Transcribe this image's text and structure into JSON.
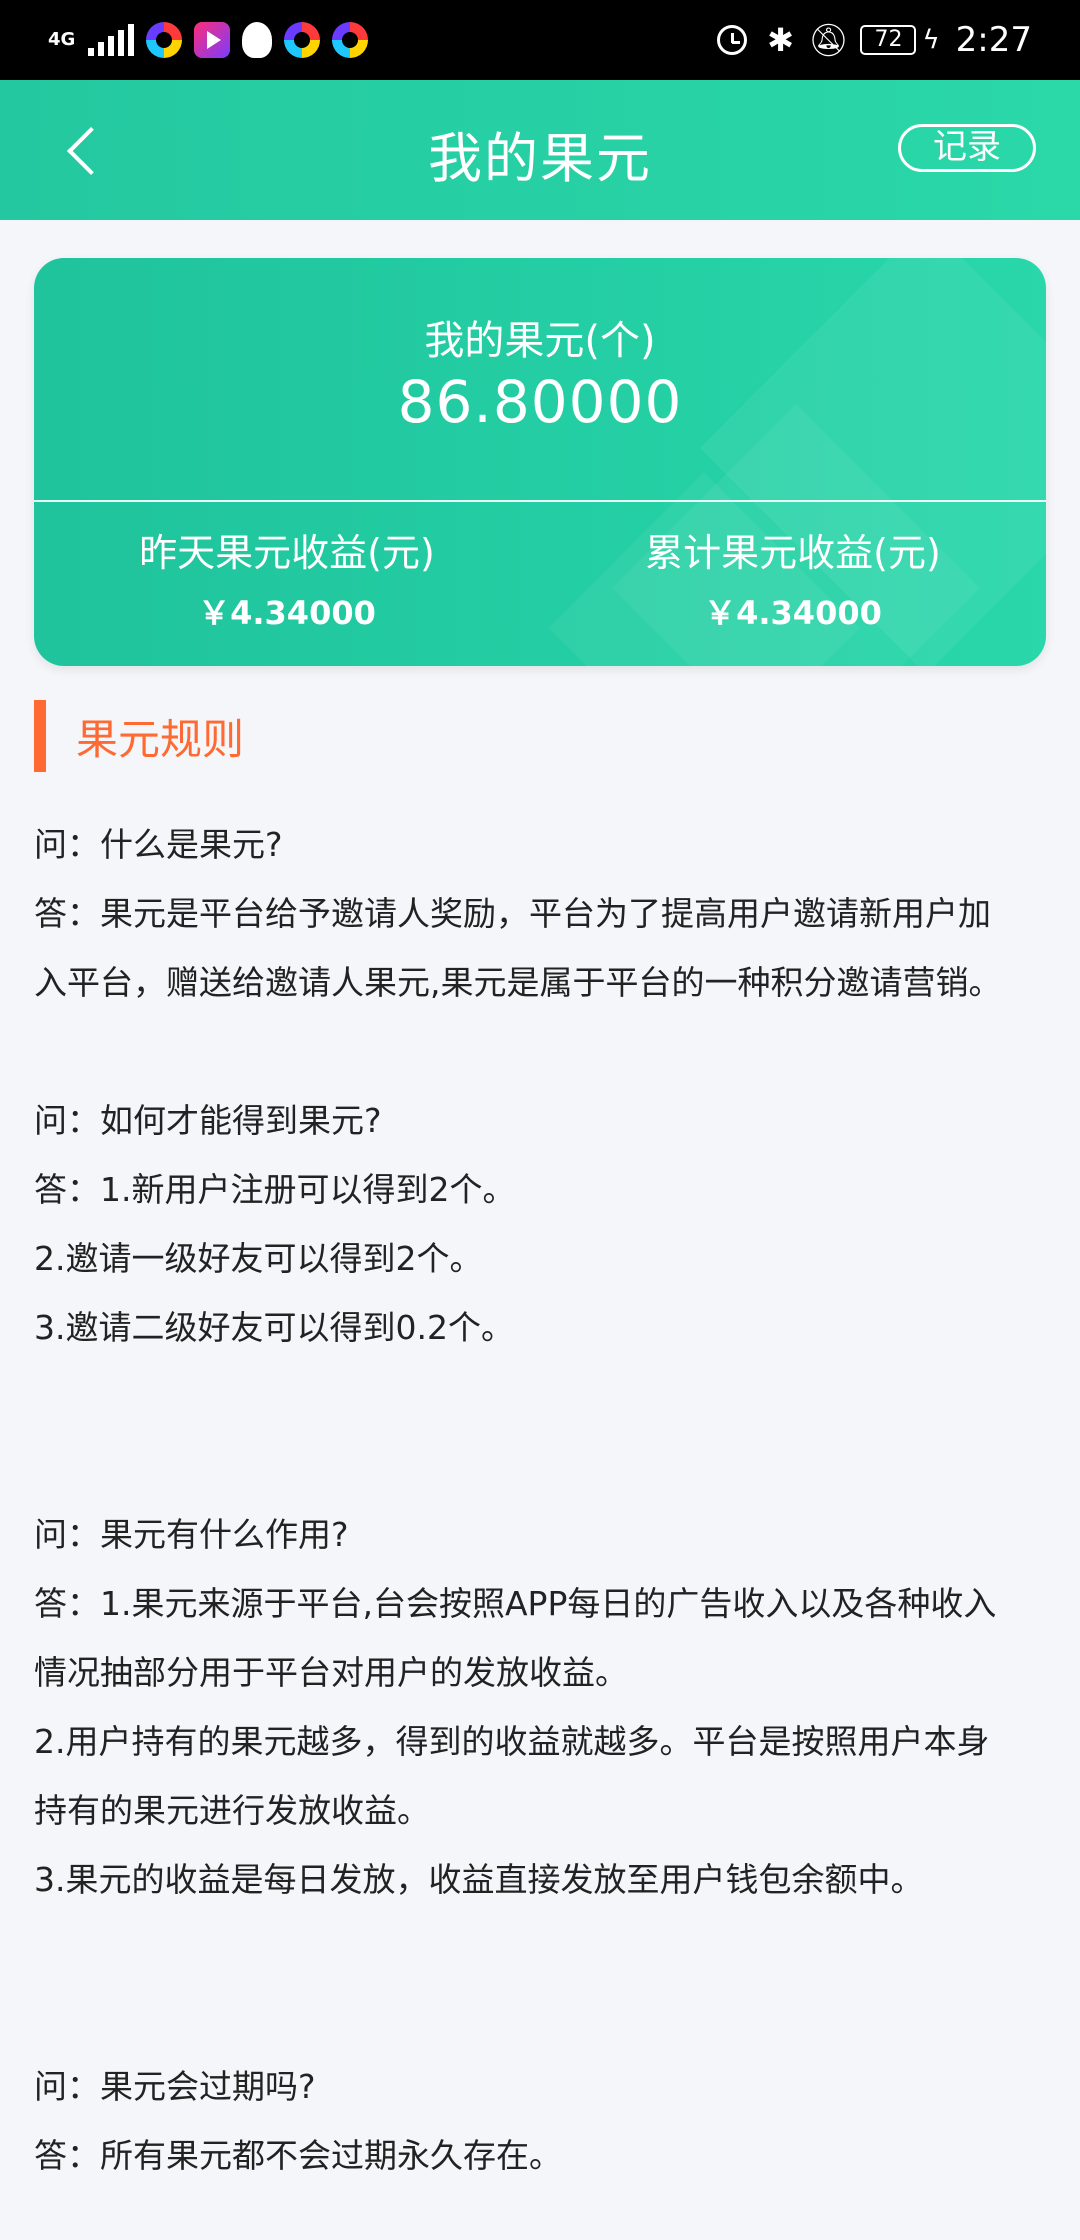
{
  "status_bar": {
    "network": "4G",
    "battery": "72",
    "time": "2:27"
  },
  "header": {
    "title": "我的果元",
    "record_label": "记录"
  },
  "card": {
    "label": "我的果元(个)",
    "amount": "86.80000",
    "yesterday_label": "昨天果元收益(元)",
    "yesterday_value": "￥4.34000",
    "total_label": "累计果元收益(元)",
    "total_value": "￥4.34000"
  },
  "section": {
    "title": "果元规则"
  },
  "faq": {
    "q1": "问：什么是果元?",
    "a1_line1": "答：果元是平台给予邀请人奖励，平台为了提高用户邀请新用户加",
    "a1_line2": "入平台，赠送给邀请人果元,果元是属于平台的一种积分邀请营销。",
    "q2": "问：如何才能得到果元?",
    "a2_line1": "答：1.新用户注册可以得到2个。",
    "a2_line2": "2.邀请一级好友可以得到2个。",
    "a2_line3": "3.邀请二级好友可以得到0.2个。",
    "q3": "问：果元有什么作用?",
    "a3_line1": "答：1.果元来源于平台,台会按照APP每日的广告收入以及各种收入",
    "a3_line2": "情况抽部分用于平台对用户的发放收益。",
    "a3_line3": "2.用户持有的果元越多，得到的收益就越多。平台是按照用户本身",
    "a3_line4": "持有的果元进行发放收益。",
    "a3_line5": "3.果元的收益是每日发放，收益直接发放至用户钱包余额中。",
    "q4": "问：果元会过期吗?",
    "a4_line1": "答：所有果元都不会过期永久存在。"
  }
}
